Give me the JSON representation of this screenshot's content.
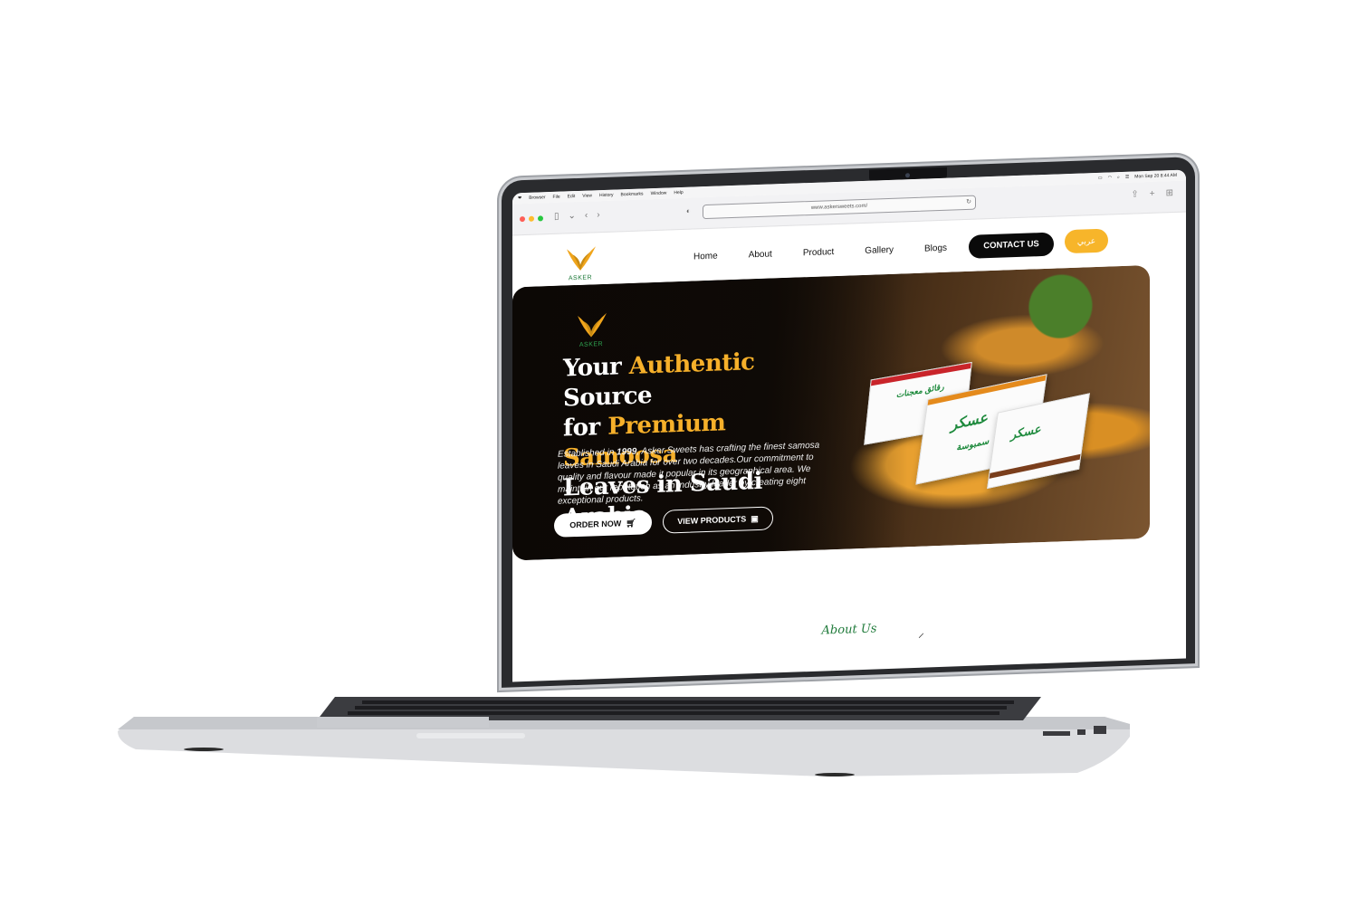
{
  "menubar": {
    "items": [
      "Browser",
      "File",
      "Edit",
      "View",
      "History",
      "Bookmarks",
      "Window",
      "Help"
    ],
    "datetime": "Mon Sep 20  8:44 AM"
  },
  "browser": {
    "url": "www.askersweets.com/"
  },
  "site": {
    "logo_text": "ASKER",
    "nav": [
      "Home",
      "About",
      "Product",
      "Gallery",
      "Blogs"
    ],
    "contact_label": "CONTACT US",
    "lang_label": "عربي"
  },
  "hero": {
    "logo_text": "ASKER",
    "title": {
      "l1a": "Your ",
      "l1b": "Authentic",
      "l1c": " Source",
      "l2a": "for ",
      "l2b": "Premium Samoosa",
      "l3": "Leaves in Saudi Arabia"
    },
    "desc_a": "Established in ",
    "desc_year": "1999",
    "desc_b": ", Asker Sweets has crafting the finest samosa leaves in Saudi Arabia for over two decades.Our commitment to quality and flavour made it popular in its geographical area. We maintain our reputation as an industry leader by creating eight exceptional products.",
    "order_label": "ORDER NOW",
    "view_label": "VIEW PRODUCTS",
    "box_text": [
      "رقائق معجنات",
      "عسكر",
      "سمبوسة"
    ]
  },
  "about": {
    "title": "About Us"
  },
  "colors": {
    "accent": "#f6b02a",
    "brand_green": "#1f7a3a",
    "dark": "#0a0a0a"
  },
  "icons": {
    "cart": "cart-icon",
    "bag": "bag-icon"
  }
}
